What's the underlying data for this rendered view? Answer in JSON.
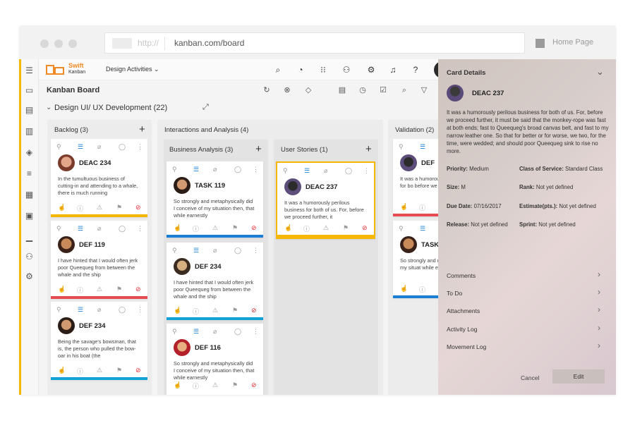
{
  "browser": {
    "url_protocol": "http://",
    "url": "kanban.com/board",
    "home_label": "Home Page"
  },
  "topbar": {
    "logo_name": "Swift",
    "logo_sub": "Kanban",
    "project": "Design Activities"
  },
  "board": {
    "title": "Kanban Board",
    "swimlane": "Design UI/ UX Development (22)"
  },
  "columns": {
    "backlog": {
      "title": "Backlog (3)",
      "cards": [
        {
          "id": "DEAC 234",
          "text": "In the tumultuous business of cutting-in and attending to a whale, there is much running",
          "bar": "#f5b800"
        },
        {
          "id": "DEF 119",
          "text": "I have hinted that I would often jerk poor Queequeg from between the whale and the ship",
          "bar": "#e84b52"
        },
        {
          "id": "DEF 234",
          "text": "Being the savage's bowsman, that is, the person who pulled the bow-oar in his boat (the",
          "bar": "#13a2d6"
        }
      ]
    },
    "interactions": {
      "title": "Interactions and Analysis (4)",
      "business": {
        "title": "Business Analysis (3)",
        "cards": [
          {
            "id": "TASK 119",
            "text": "So strongly and metaphysically did I conceive of my situation then, that while earnestly",
            "bar": "#1a7fd4"
          },
          {
            "id": "DEF 234",
            "text": "I have hinted that I would often jerk poor Queequeg from between the whale and the ship",
            "bar": "#13a2d6"
          },
          {
            "id": "DEF 116",
            "text": "So strongly and metaphysically did I conceive of my situation then, that while earnestly",
            "bar": ""
          }
        ]
      },
      "stories": {
        "title": "User Stories (1)",
        "cards": [
          {
            "id": "DEAC 237",
            "text": "It was a humorously perilous business for both of us. For, before we proceed further, it",
            "bar": "#f5b800"
          }
        ]
      }
    },
    "validation": {
      "title": "Validation (2)",
      "cards": [
        {
          "id": "DEF",
          "text": "It was a humorously peril business for bo before we proceed",
          "bar": "#e84b52"
        },
        {
          "id": "TASK",
          "text": "So strongly and metap conceive of my situat while earnestly",
          "bar": "#1a7fd4"
        }
      ]
    }
  },
  "panel": {
    "title": "Card Details",
    "card_id": "DEAC 237",
    "description": "It was a humorously perilous business for both of us. For, before we proceed further, it must be said that the monkey-rope was fast at both ends; fast to Queequeg's broad canvas belt, and fast to my narrow leather one. So that for better or for worse, we two, for the time, were wedded; and should poor Queequeg sink to rise no more.",
    "priority_label": "Priority:",
    "priority": "Medium",
    "cos_label": "Class of Service:",
    "cos": "Standard Class",
    "size_label": "Size:",
    "size": "M",
    "rank_label": "Rank:",
    "rank": "Not yet defined",
    "due_label": "Due Date:",
    "due": "07/16/2017",
    "estimate_label": "Estimate(pts.):",
    "estimate": "Not yet defined",
    "release_label": "Release:",
    "release": "Not yet defined",
    "sprint_label": "Sprint:",
    "sprint": "Not yet defined",
    "links": [
      "Comments",
      "To Do",
      "Attachments",
      "Activity Log",
      "Movement Log"
    ],
    "cancel": "Cancel",
    "edit": "Edit"
  }
}
